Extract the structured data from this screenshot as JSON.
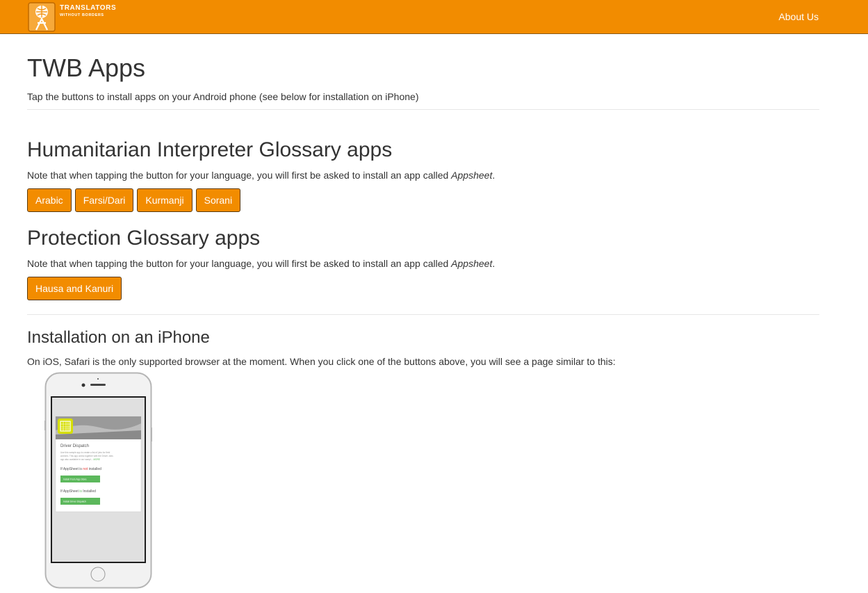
{
  "brand": {
    "line1": "TRANSLATORS",
    "line2": "WITHOUT BORDERS",
    "color": "#f28c00"
  },
  "nav": {
    "about": "About Us"
  },
  "page": {
    "title": "TWB Apps",
    "intro": "Tap the buttons to install apps on your Android phone (see below for installation on iPhone)"
  },
  "sections": {
    "interpreter": {
      "heading": "Humanitarian Interpreter Glossary apps",
      "note_prefix": "Note that when tapping the button for your language, you will first be asked to install an app called ",
      "note_app": "Appsheet",
      "note_suffix": ".",
      "buttons": [
        "Arabic",
        "Farsi/Dari",
        "Kurmanji",
        "Sorani"
      ]
    },
    "protection": {
      "heading": "Protection Glossary apps",
      "note_prefix": "Note that when tapping the button for your language, you will first be asked to install an app called ",
      "note_app": "Appsheet",
      "note_suffix": ".",
      "buttons": [
        "Hausa and Kanuri"
      ]
    },
    "iphone": {
      "heading": "Installation on an iPhone",
      "text": "On iOS, Safari is the only supported browser at the moment. When you click one of the buttons above, you will see a page similar to this:"
    }
  },
  "phone_screen": {
    "app_title": "Driver Dispatch",
    "app_desc_1": "Use this sample app to create a list of jobs for field",
    "app_desc_2": "workers. This app works together with the Driver Jobs",
    "app_desc_3": "app also available in our sampl...",
    "app_desc_more": "MORE",
    "not_installed_pre": "If AppSheet is ",
    "not_installed_word": "not",
    "not_installed_post": " installed",
    "btn_app_store": "Install From App Store",
    "installed_pre": "If AppSheet ",
    "installed_word": "is",
    "installed_post": " Installed",
    "btn_install": "Install Driver Dispatch"
  }
}
